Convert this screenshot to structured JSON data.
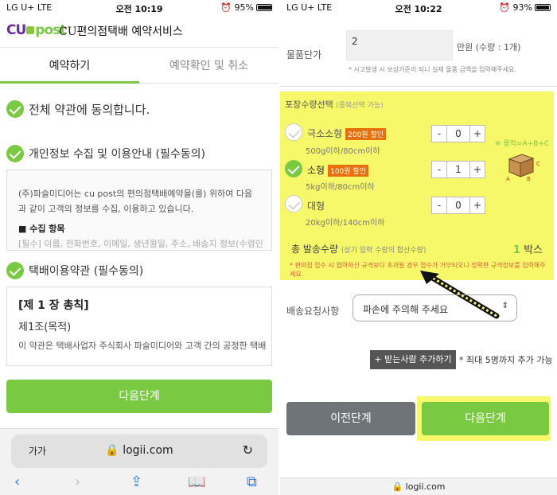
{
  "left": {
    "status": {
      "carrier": "LG U+  LTE",
      "time": "오전 10:19",
      "battery": "95%"
    },
    "logo": {
      "cu": "CU",
      "post": "post"
    },
    "header_title": "CU편의점택배 예약서비스",
    "tabs": [
      "예약하기",
      "예약확인 및 취소"
    ],
    "agree_all": "전체 약관에 동의합니다.",
    "privacy_label": "개인정보 수집 및 이용안내 (필수동의)",
    "privacy_text": "(주)파슬미디어는 cu post의 편의점택배예약을(를) 위하여 다음과 같이 고객의 정보를 수집, 이용하고 있습니다.",
    "privacy_heading": "■ 수집 항목",
    "privacy_cut": "[필수] 이름, 전화번호, 이메일, 생년월일, 주소, 배송지 정보(수령인",
    "delivery_label": "택배이용약관 (필수동의)",
    "terms_chapter": "[제 1 장 총칙]",
    "terms_article": "제1조(목적)",
    "terms_text": "이 약관은 택배사업자 주식회사 파슬미디어와 고객 간의 공정한 택배",
    "next": "다음단계",
    "safari": {
      "aa": "가가",
      "domain": "logii.com"
    }
  },
  "right": {
    "status": {
      "carrier": "LG U+  LTE",
      "time": "오전 10:22",
      "battery": "93%"
    },
    "price_label": "물품단가",
    "price_value": "2",
    "price_unit": "만원 (수량 : 1개)",
    "price_note": "* 사고발생 시 보상기준이 되니 실제 물품 금액을 입력해주세요.",
    "pack_title": "포장수량선택",
    "pack_sub": "(중복선택 가능)",
    "sizes": [
      {
        "name": "극소소형",
        "badge": "200원 할인",
        "spec": "500g이하/80cm이하",
        "qty": "0",
        "checked": false
      },
      {
        "name": "소형",
        "badge": "100원 할인",
        "spec": "5kg이하/80cm이하",
        "qty": "1",
        "checked": true
      },
      {
        "name": "대형",
        "badge": "",
        "spec": "20kg이하/140cm이하",
        "qty": "0",
        "checked": false
      }
    ],
    "volume": "※ 용적=A+B+C",
    "box_labels": [
      "A",
      "B",
      "C"
    ],
    "total_label": "총 발송수량",
    "total_sub": "(상기 입력 수량의 합산수량)",
    "total_value": "1",
    "total_unit": "박스",
    "warning": "* 편의점 접수 시 입력하신 규격보다 초과될 경우 접수가 거부되오니 정확한 규격정보를 입력해주세요.",
    "request_label": "배송요청사항",
    "request_value": "파손에 주의해 주세요",
    "add_btn": "+ 받는사람 추가하기",
    "add_note": "* 최대 5명까지 추가 가능",
    "prev": "이전단계",
    "next": "다음단계",
    "domain": "logii.com"
  }
}
